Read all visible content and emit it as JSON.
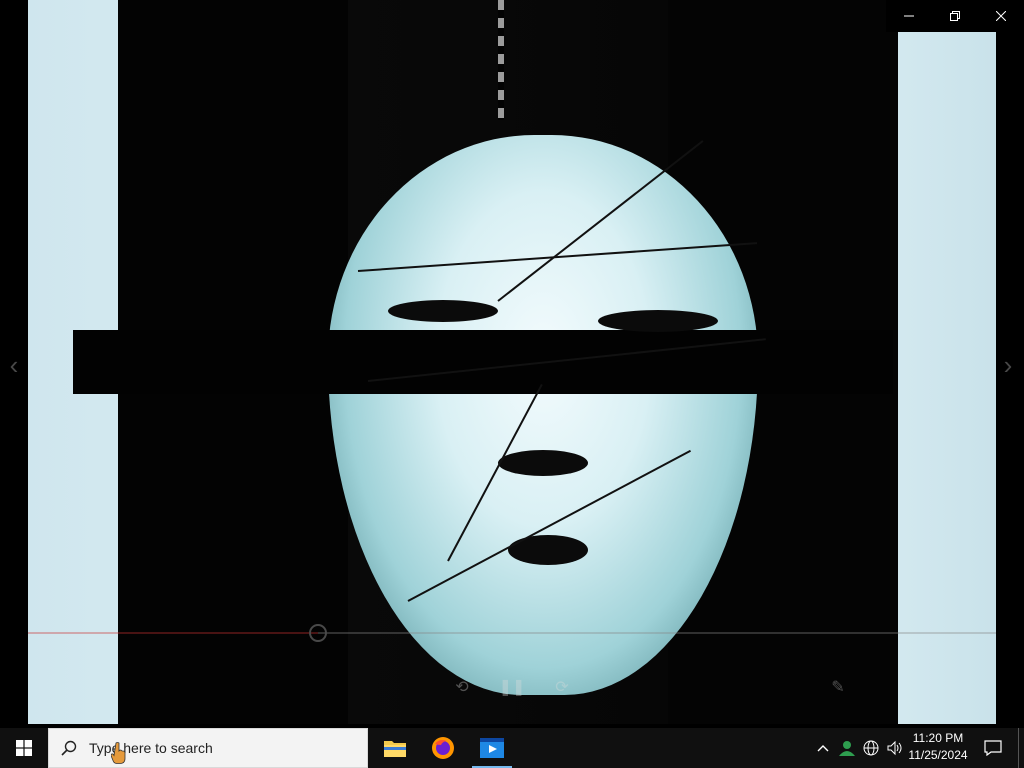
{
  "window": {
    "caption_buttons": [
      {
        "name": "minimize",
        "icon": "minimize-icon"
      },
      {
        "name": "restore",
        "icon": "restore-icon"
      },
      {
        "name": "close",
        "icon": "close-icon"
      }
    ]
  },
  "player": {
    "progress": 0.3,
    "controls": {
      "rewind_icon": "rewind-10-icon",
      "play_pause_icon": "pause-icon",
      "forward_icon": "forward-30-icon",
      "edit_icon": "pencil-icon"
    },
    "prev_icon": "chevron-left-icon",
    "next_icon": "chevron-right-icon"
  },
  "taskbar": {
    "search_placeholder": "Type here to search",
    "apps": [
      {
        "name": "file-explorer",
        "icon": "folder-icon",
        "active": false
      },
      {
        "name": "firefox",
        "icon": "firefox-icon",
        "active": false
      },
      {
        "name": "movies-tv",
        "icon": "video-player-icon",
        "active": true
      }
    ],
    "tray": {
      "show_hidden_icon": "chevron-up-icon",
      "people_icon": "people-icon",
      "network_icon": "globe-icon",
      "volume_icon": "speaker-icon"
    },
    "clock": {
      "time": "11:20 PM",
      "date": "11/25/2024"
    },
    "notification_icon": "notification-icon"
  },
  "colors": {
    "taskbar_bg": "#101010",
    "accent": "#76b9ed",
    "search_bg": "#f3f3f3",
    "seek_fill": "#cc3333"
  }
}
